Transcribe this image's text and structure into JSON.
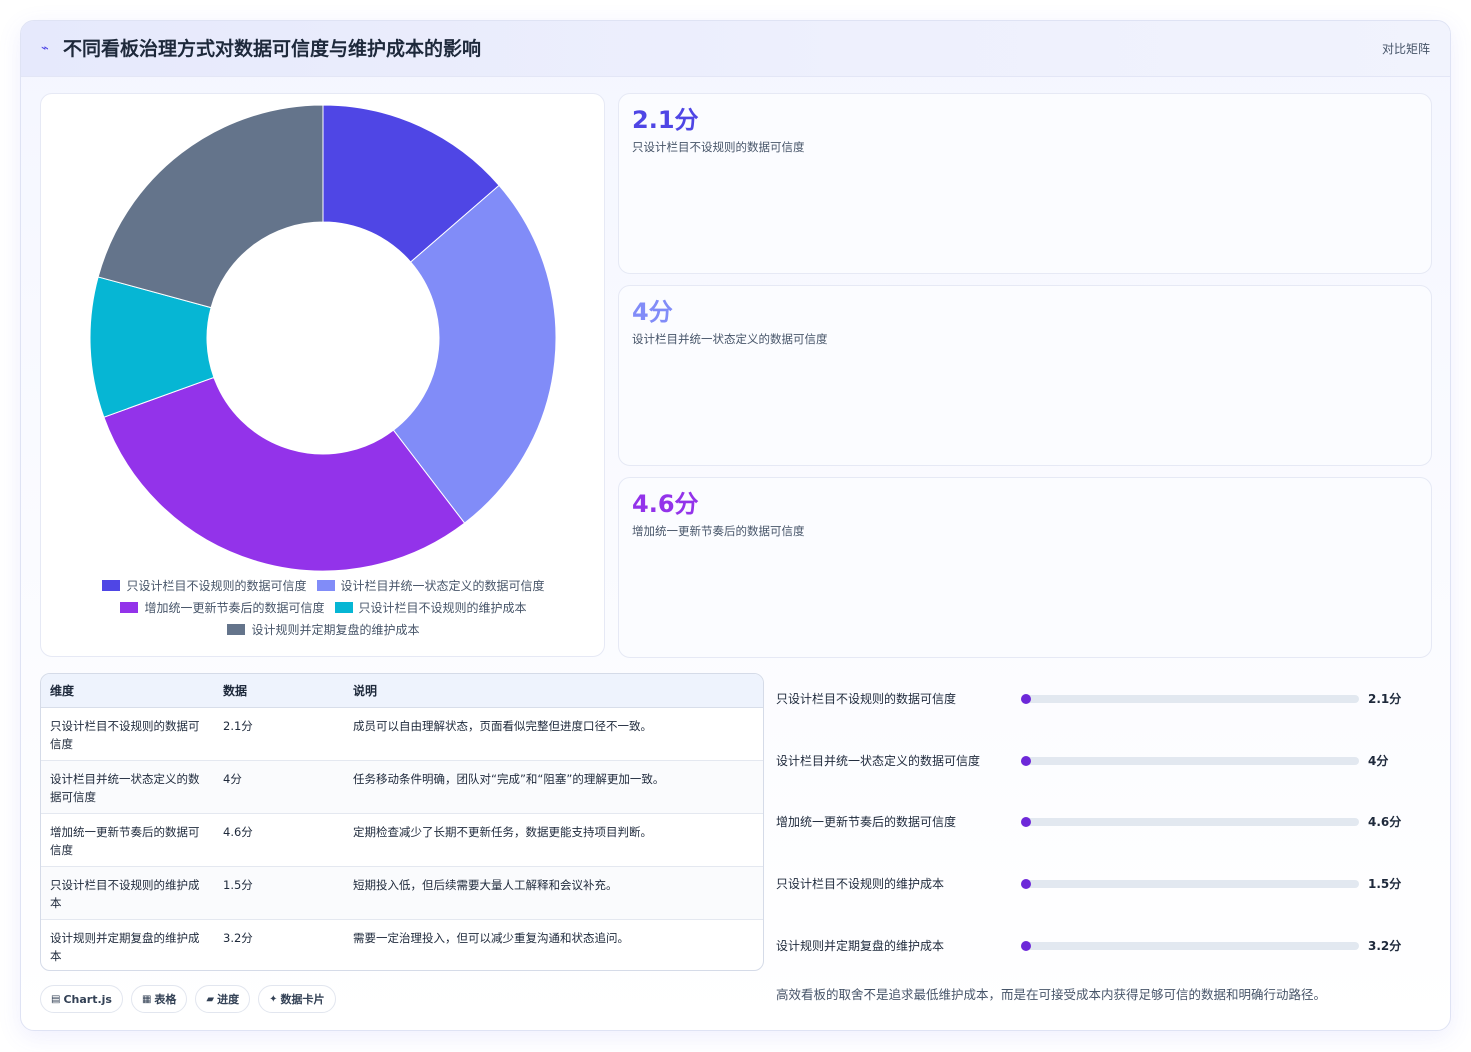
{
  "header": {
    "title": "不同看板治理方式对数据可信度与维护成本的影响",
    "right_label": "对比矩阵",
    "icon": "sparkline-icon"
  },
  "chart_data": {
    "type": "pie",
    "categories": [
      "只设计栏目不设规则的数据可信度",
      "设计栏目并统一状态定义的数据可信度",
      "增加统一更新节奏后的数据可信度",
      "只设计栏目不设规则的维护成本",
      "设计规则并定期复盘的维护成本"
    ],
    "values": [
      2.1,
      4,
      4.6,
      1.5,
      3.2
    ],
    "colors": [
      "#4f46e5",
      "#818cf8",
      "#9333ea",
      "#06b6d4",
      "#64748b"
    ],
    "donut": true,
    "legend": "bottom",
    "title": ""
  },
  "kpis": [
    {
      "value": "2.1分",
      "label": "只设计栏目不设规则的数据可信度",
      "color": "#4f46e5"
    },
    {
      "value": "4分",
      "label": "设计栏目并统一状态定义的数据可信度",
      "color": "#818cf8"
    },
    {
      "value": "4.6分",
      "label": "增加统一更新节奏后的数据可信度",
      "color": "#9333ea"
    }
  ],
  "table": {
    "headers": [
      "维度",
      "数据",
      "说明"
    ],
    "rows": [
      [
        "只设计栏目不设规则的数据可信度",
        "2.1分",
        "成员可以自由理解状态，页面看似完整但进度口径不一致。"
      ],
      [
        "设计栏目并统一状态定义的数据可信度",
        "4分",
        "任务移动条件明确，团队对“完成”和“阻塞”的理解更加一致。"
      ],
      [
        "增加统一更新节奏后的数据可信度",
        "4.6分",
        "定期检查减少了长期不更新任务，数据更能支持项目判断。"
      ],
      [
        "只设计栏目不设规则的维护成本",
        "1.5分",
        "短期投入低，但后续需要大量人工解释和会议补充。"
      ],
      [
        "设计规则并定期复盘的维护成本",
        "3.2分",
        "需要一定治理投入，但可以减少重复沟通和状态追问。"
      ]
    ]
  },
  "progress": {
    "max": 5,
    "items": [
      {
        "label": "只设计栏目不设规则的数据可信度",
        "value": 2.1,
        "display": "2.1分"
      },
      {
        "label": "设计栏目并统一状态定义的数据可信度",
        "value": 4,
        "display": "4分"
      },
      {
        "label": "增加统一更新节奏后的数据可信度",
        "value": 4.6,
        "display": "4.6分"
      },
      {
        "label": "只设计栏目不设规则的维护成本",
        "value": 1.5,
        "display": "1.5分"
      },
      {
        "label": "设计规则并定期复盘的维护成本",
        "value": 3.2,
        "display": "3.2分"
      }
    ]
  },
  "footer_note": "高效看板的取舍不是追求最低维护成本，而是在可接受成本内获得足够可信的数据和明确行动路径。",
  "chips": [
    {
      "icon": "▤",
      "label": "Chart.js"
    },
    {
      "icon": "▦",
      "label": "表格"
    },
    {
      "icon": "▰",
      "label": "进度"
    },
    {
      "icon": "✦",
      "label": "数据卡片"
    }
  ]
}
